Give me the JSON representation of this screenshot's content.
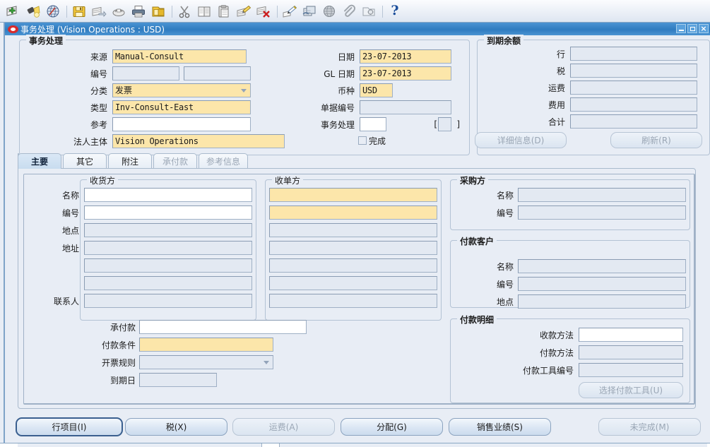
{
  "toolbar": {
    "icons": [
      "new-record-icon",
      "flashlight-find-icon",
      "show-navigator-icon",
      "separator",
      "save-icon",
      "next-step-icon",
      "print-preview-icon",
      "print-icon",
      "close-form-icon",
      "separator",
      "cut-icon",
      "copy-icon",
      "paste-icon",
      "edit-icon",
      "clear-record-icon",
      "separator",
      "edit-field-icon",
      "translations-icon",
      "attachments-globe-icon",
      "attachment-paperclip-icon",
      "folder-tools-icon",
      "separator",
      "help-icon"
    ],
    "help_label": "?"
  },
  "window": {
    "title": "事务处理  (Vision Operations : USD)",
    "minimize_label": "",
    "maximize_label": "",
    "close_label": "×"
  },
  "header": {
    "group_title": "事务处理",
    "fields": {
      "source_label": "来源",
      "source_value": "Manual-Consult",
      "number_label": "编号",
      "number_value": "",
      "number2_value": "",
      "class_label": "分类",
      "class_value": "发票",
      "type_label": "类型",
      "type_value": "Inv-Consult-East",
      "reference_label": "参考",
      "reference_value": "",
      "legal_entity_label": "法人主体",
      "legal_entity_value": "Vision Operations",
      "date_label": "日期",
      "date_value": "23-07-2013",
      "gl_date_label": "GL 日期",
      "gl_date_value": "23-07-2013",
      "currency_label": "币种",
      "currency_value": "USD",
      "document_number_label": "单据编号",
      "document_number_value": "",
      "transaction_label": "事务处理",
      "transaction_value": "",
      "bracket_open": "[",
      "bracket_value": "",
      "bracket_close": "]",
      "complete_label": "完成",
      "complete_checked": false
    }
  },
  "balance": {
    "group_title": "到期余额",
    "rows": [
      {
        "label": "行",
        "value": ""
      },
      {
        "label": "税",
        "value": ""
      },
      {
        "label": "运费",
        "value": ""
      },
      {
        "label": "费用",
        "value": ""
      },
      {
        "label": "合计",
        "value": ""
      }
    ],
    "details_button": "详细信息(D)",
    "refresh_button": "刷新(R)"
  },
  "tabs": [
    {
      "label": "主要",
      "state": "active"
    },
    {
      "label": "其它",
      "state": "normal"
    },
    {
      "label": "附注",
      "state": "normal"
    },
    {
      "label": "承付款",
      "state": "disabled"
    },
    {
      "label": "参考信息",
      "state": "disabled"
    }
  ],
  "ship_to": {
    "group_title": "收货方",
    "labels": [
      "名称",
      "编号",
      "地点",
      "地址",
      "",
      "",
      "联系人"
    ],
    "values": [
      "",
      "",
      "",
      "",
      "",
      "",
      ""
    ],
    "states": [
      "edit",
      "edit",
      "ro",
      "ro",
      "ro",
      "ro",
      "ro"
    ]
  },
  "bill_to": {
    "group_title": "收单方",
    "values": [
      "",
      "",
      "",
      "",
      "",
      "",
      ""
    ],
    "states": [
      "req",
      "req",
      "ro",
      "ro",
      "ro",
      "ro",
      "ro"
    ]
  },
  "paying_customer": {
    "group_title": "采购方",
    "rows": [
      {
        "label": "名称",
        "value": ""
      },
      {
        "label": "编号",
        "value": ""
      }
    ]
  },
  "payment_customer": {
    "group_title": "付款客户",
    "rows": [
      {
        "label": "名称",
        "value": ""
      },
      {
        "label": "编号",
        "value": ""
      },
      {
        "label": "地点",
        "value": ""
      }
    ]
  },
  "terms": {
    "commitment_label": "承付款",
    "commitment_value": "",
    "payment_terms_label": "付款条件",
    "payment_terms_value": "",
    "invoicing_rule_label": "开票规则",
    "invoicing_rule_value": "",
    "due_date_label": "到期日",
    "due_date_value": ""
  },
  "payment_details": {
    "group_title": "付款明细",
    "rows": [
      {
        "label": "收款方法",
        "value": "",
        "state": "edit"
      },
      {
        "label": "付款方法",
        "value": "",
        "state": "ro"
      },
      {
        "label": "付款工具编号",
        "value": "",
        "state": "ro"
      }
    ],
    "select_button": "选择付款工具(U)"
  },
  "action_buttons": [
    {
      "label": "行项目(I)",
      "state": "focus"
    },
    {
      "label": "税(X)",
      "state": "enabled"
    },
    {
      "label": "运费(A)",
      "state": "disabled"
    },
    {
      "label": "分配(G)",
      "state": "enabled"
    },
    {
      "label": "销售业绩(S)",
      "state": "enabled"
    },
    {
      "label": "未完成(M)",
      "state": "disabled"
    }
  ],
  "colors": {
    "required_field": "#fce6aa",
    "editable_field": "#ffffff",
    "readonly_field": "#e3e9f2",
    "titlebar": "#2f7cc0",
    "canvas": "#e8edf5"
  }
}
